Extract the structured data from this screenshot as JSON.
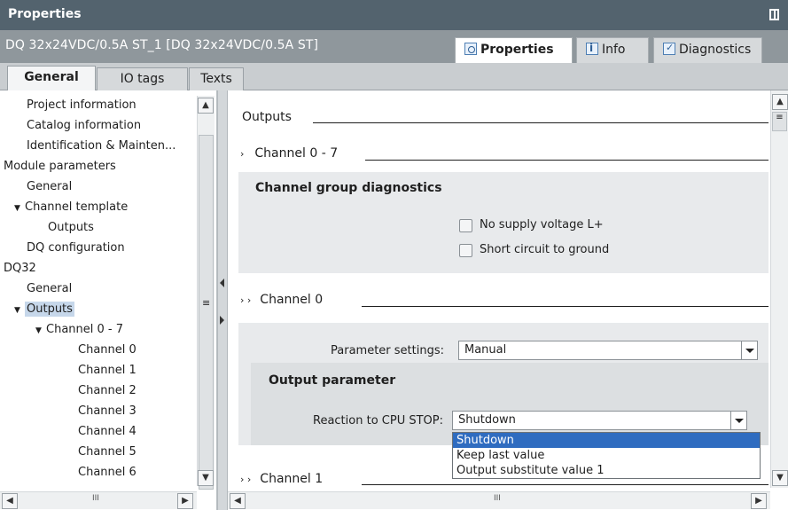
{
  "window": {
    "title": "Properties"
  },
  "header": {
    "module_name": "DQ 32x24VDC/0.5A ST_1 [DQ 32x24VDC/0.5A ST]",
    "tabs": [
      {
        "label": "Properties",
        "icon": "properties-icon",
        "active": true
      },
      {
        "label": "Info",
        "icon": "info-icon",
        "active": false
      },
      {
        "label": "Diagnostics",
        "icon": "diagnostics-icon",
        "active": false
      }
    ]
  },
  "left_tabs": [
    {
      "label": "General",
      "active": true
    },
    {
      "label": "IO tags",
      "active": false
    },
    {
      "label": "Texts",
      "active": false
    }
  ],
  "nav": {
    "items": [
      {
        "label": "Project information",
        "indent": 1,
        "arrow": ""
      },
      {
        "label": "Catalog information",
        "indent": 1,
        "arrow": ""
      },
      {
        "label": "Identification & Mainten...",
        "indent": 1,
        "arrow": ""
      },
      {
        "label": "Module parameters",
        "indent": 0,
        "arrow": "▼"
      },
      {
        "label": "General",
        "indent": 1,
        "arrow": ""
      },
      {
        "label": "Channel template",
        "indent": 1,
        "arrow": "▼"
      },
      {
        "label": "Outputs",
        "indent": 2,
        "arrow": ""
      },
      {
        "label": "DQ configuration",
        "indent": 1,
        "arrow": ""
      },
      {
        "label": "DQ32",
        "indent": 0,
        "arrow": "▼"
      },
      {
        "label": "General",
        "indent": 1,
        "arrow": ""
      },
      {
        "label": "Outputs",
        "indent": 1,
        "arrow": "▼",
        "selected": true
      },
      {
        "label": "Channel 0 - 7",
        "indent": 2,
        "arrow": "▼"
      },
      {
        "label": "Channel 0",
        "indent": 3,
        "arrow": ""
      },
      {
        "label": "Channel 1",
        "indent": 3,
        "arrow": ""
      },
      {
        "label": "Channel 2",
        "indent": 3,
        "arrow": ""
      },
      {
        "label": "Channel 3",
        "indent": 3,
        "arrow": ""
      },
      {
        "label": "Channel 4",
        "indent": 3,
        "arrow": ""
      },
      {
        "label": "Channel 5",
        "indent": 3,
        "arrow": ""
      },
      {
        "label": "Channel 6",
        "indent": 3,
        "arrow": ""
      }
    ]
  },
  "main": {
    "outputs_title": "Outputs",
    "group": {
      "title": "Channel 0 - 7",
      "diag_title": "Channel group diagnostics",
      "checkbox1": "No supply voltage L+",
      "checkbox2": "Short circuit to ground"
    },
    "channel0": {
      "title": "Channel 0",
      "param_label": "Parameter settings:",
      "param_value": "Manual",
      "output_param_title": "Output parameter",
      "reaction_label": "Reaction to CPU STOP:",
      "reaction_value": "Shutdown",
      "options": [
        "Shutdown",
        "Keep last value",
        "Output substitute value 1"
      ]
    },
    "channel1": {
      "title": "Channel 1"
    }
  },
  "scroll": {
    "thumb_glyph": "≡",
    "h_glyph": "III"
  }
}
